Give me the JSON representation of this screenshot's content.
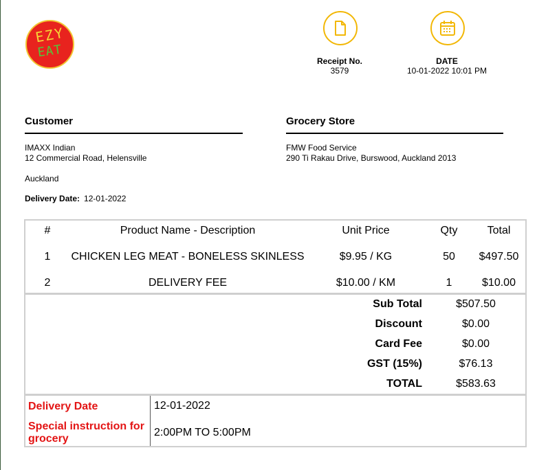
{
  "logo": {
    "line1": "EZY",
    "line2": "EAT",
    "colors": {
      "background": "#e8231e",
      "line1": "#f5d637",
      "line2": "#58c23a"
    }
  },
  "icons": {
    "receipt": "document-icon",
    "date": "calendar-icon",
    "accent": "#f2b705"
  },
  "receipt": {
    "label": "Receipt No.",
    "value": "3579"
  },
  "date": {
    "label": "DATE",
    "value": "10-01-2022 10:01 PM"
  },
  "customer": {
    "heading": "Customer",
    "name": "IMAXX Indian",
    "street": "12 Commercial Road, Helensville",
    "city": "Auckland",
    "delivery_label": "Delivery Date:",
    "delivery_value": "12-01-2022"
  },
  "store": {
    "heading": "Grocery Store",
    "name": "FMW Food Service",
    "street": "290 Ti Rakau Drive, Burswood, Auckland 2013"
  },
  "table": {
    "headers": [
      "#",
      "Product Name - Description",
      "Unit Price",
      "Qty",
      "Total"
    ],
    "rows": [
      {
        "num": "1",
        "name": "CHICKEN LEG MEAT - BONELESS SKINLESS",
        "price": "$9.95 / KG",
        "qty": "50",
        "total": "$497.50"
      },
      {
        "num": "2",
        "name": "DELIVERY FEE",
        "price": "$10.00 / KM",
        "qty": "1",
        "total": "$10.00"
      }
    ]
  },
  "totals": [
    {
      "label": "Sub Total",
      "value": "$507.50"
    },
    {
      "label": "Discount",
      "value": "$0.00"
    },
    {
      "label": "Card Fee",
      "value": "$0.00"
    },
    {
      "label": "GST (15%)",
      "value": "$76.13"
    },
    {
      "label": "TOTAL",
      "value": "$583.63"
    }
  ],
  "instructions": {
    "delivery_label": "Delivery Date",
    "delivery_value": "12-01-2022",
    "special_label": "Special instruction for grocery",
    "special_value": "2:00PM TO 5:00PM",
    "label_color": "#e31414"
  }
}
